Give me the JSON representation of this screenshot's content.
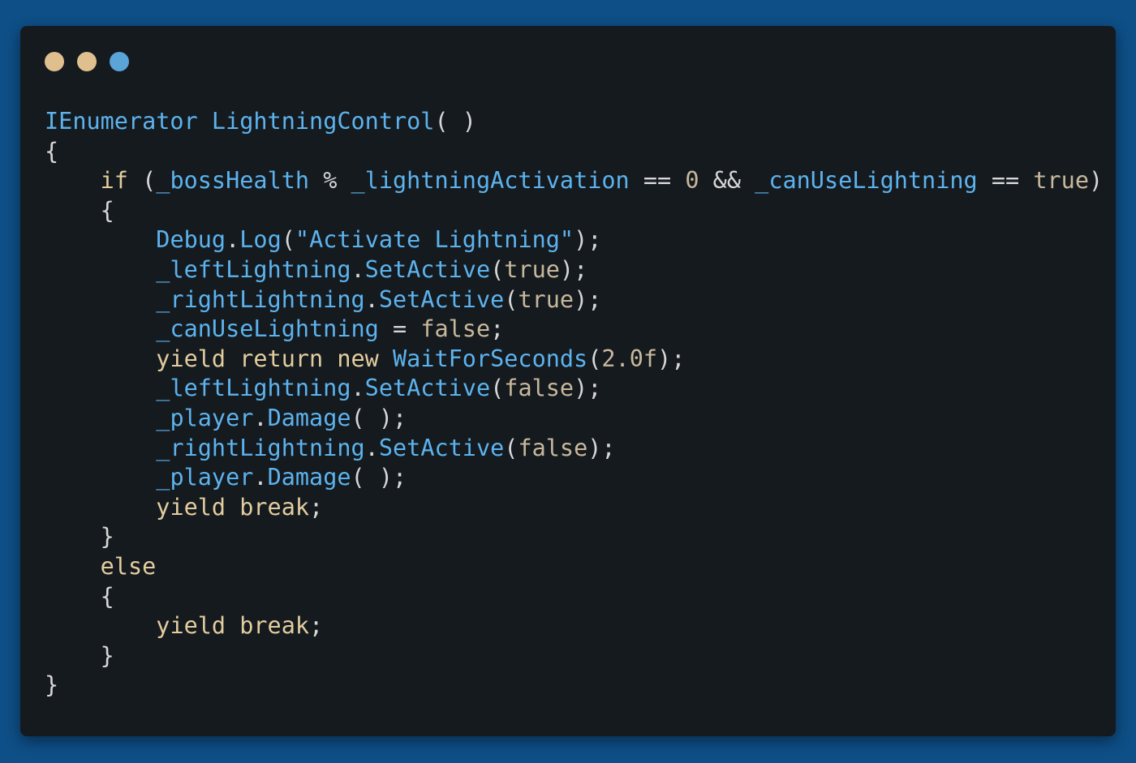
{
  "window": {
    "buttons": [
      {
        "name": "close-button",
        "color": "#e0bf8f"
      },
      {
        "name": "minimize-button",
        "color": "#e0bf8f"
      },
      {
        "name": "maximize-button",
        "color": "#5aa4d8"
      }
    ]
  },
  "code": {
    "lines": [
      {
        "indent": 0,
        "tokens": [
          {
            "t": "type",
            "v": "IEnumerator"
          },
          {
            "t": "punc",
            "v": " "
          },
          {
            "t": "ident",
            "v": "LightningControl"
          },
          {
            "t": "punc",
            "v": "( )"
          }
        ]
      },
      {
        "indent": 0,
        "tokens": [
          {
            "t": "punc",
            "v": "{"
          }
        ]
      },
      {
        "indent": 4,
        "tokens": [
          {
            "t": "kw",
            "v": "if"
          },
          {
            "t": "punc",
            "v": " ("
          },
          {
            "t": "ident",
            "v": "_bossHealth"
          },
          {
            "t": "op",
            "v": " % "
          },
          {
            "t": "ident",
            "v": "_lightningActivation"
          },
          {
            "t": "op",
            "v": " == "
          },
          {
            "t": "num",
            "v": "0"
          },
          {
            "t": "op",
            "v": " && "
          },
          {
            "t": "ident",
            "v": "_canUseLightning"
          },
          {
            "t": "op",
            "v": " == "
          },
          {
            "t": "lit",
            "v": "true"
          },
          {
            "t": "punc",
            "v": ")"
          }
        ]
      },
      {
        "indent": 4,
        "tokens": [
          {
            "t": "punc",
            "v": "{"
          }
        ]
      },
      {
        "indent": 8,
        "tokens": [
          {
            "t": "type",
            "v": "Debug"
          },
          {
            "t": "punc",
            "v": "."
          },
          {
            "t": "ident",
            "v": "Log"
          },
          {
            "t": "punc",
            "v": "("
          },
          {
            "t": "str",
            "v": "\"Activate Lightning\""
          },
          {
            "t": "punc",
            "v": ");"
          }
        ]
      },
      {
        "indent": 8,
        "tokens": [
          {
            "t": "ident",
            "v": "_leftLightning"
          },
          {
            "t": "punc",
            "v": "."
          },
          {
            "t": "ident",
            "v": "SetActive"
          },
          {
            "t": "punc",
            "v": "("
          },
          {
            "t": "lit",
            "v": "true"
          },
          {
            "t": "punc",
            "v": ");"
          }
        ]
      },
      {
        "indent": 8,
        "tokens": [
          {
            "t": "ident",
            "v": "_rightLightning"
          },
          {
            "t": "punc",
            "v": "."
          },
          {
            "t": "ident",
            "v": "SetActive"
          },
          {
            "t": "punc",
            "v": "("
          },
          {
            "t": "lit",
            "v": "true"
          },
          {
            "t": "punc",
            "v": ");"
          }
        ]
      },
      {
        "indent": 8,
        "tokens": [
          {
            "t": "ident",
            "v": "_canUseLightning"
          },
          {
            "t": "op",
            "v": " = "
          },
          {
            "t": "lit",
            "v": "false"
          },
          {
            "t": "punc",
            "v": ";"
          }
        ]
      },
      {
        "indent": 8,
        "tokens": [
          {
            "t": "kw",
            "v": "yield return new"
          },
          {
            "t": "punc",
            "v": " "
          },
          {
            "t": "type",
            "v": "WaitForSeconds"
          },
          {
            "t": "punc",
            "v": "("
          },
          {
            "t": "num",
            "v": "2.0f"
          },
          {
            "t": "punc",
            "v": ");"
          }
        ]
      },
      {
        "indent": 8,
        "tokens": [
          {
            "t": "ident",
            "v": "_leftLightning"
          },
          {
            "t": "punc",
            "v": "."
          },
          {
            "t": "ident",
            "v": "SetActive"
          },
          {
            "t": "punc",
            "v": "("
          },
          {
            "t": "lit",
            "v": "false"
          },
          {
            "t": "punc",
            "v": ");"
          }
        ]
      },
      {
        "indent": 8,
        "tokens": [
          {
            "t": "ident",
            "v": "_player"
          },
          {
            "t": "punc",
            "v": "."
          },
          {
            "t": "ident",
            "v": "Damage"
          },
          {
            "t": "punc",
            "v": "( );"
          }
        ]
      },
      {
        "indent": 8,
        "tokens": [
          {
            "t": "ident",
            "v": "_rightLightning"
          },
          {
            "t": "punc",
            "v": "."
          },
          {
            "t": "ident",
            "v": "SetActive"
          },
          {
            "t": "punc",
            "v": "("
          },
          {
            "t": "lit",
            "v": "false"
          },
          {
            "t": "punc",
            "v": ");"
          }
        ]
      },
      {
        "indent": 8,
        "tokens": [
          {
            "t": "ident",
            "v": "_player"
          },
          {
            "t": "punc",
            "v": "."
          },
          {
            "t": "ident",
            "v": "Damage"
          },
          {
            "t": "punc",
            "v": "( );"
          }
        ]
      },
      {
        "indent": 8,
        "tokens": [
          {
            "t": "kw",
            "v": "yield break"
          },
          {
            "t": "punc",
            "v": ";"
          }
        ]
      },
      {
        "indent": 4,
        "tokens": [
          {
            "t": "punc",
            "v": "}"
          }
        ]
      },
      {
        "indent": 4,
        "tokens": [
          {
            "t": "kw",
            "v": "else"
          }
        ]
      },
      {
        "indent": 4,
        "tokens": [
          {
            "t": "punc",
            "v": "{"
          }
        ]
      },
      {
        "indent": 8,
        "tokens": [
          {
            "t": "kw",
            "v": "yield break"
          },
          {
            "t": "punc",
            "v": ";"
          }
        ]
      },
      {
        "indent": 4,
        "tokens": [
          {
            "t": "punc",
            "v": "}"
          }
        ]
      },
      {
        "indent": 0,
        "tokens": [
          {
            "t": "punc",
            "v": "}"
          }
        ]
      }
    ]
  }
}
